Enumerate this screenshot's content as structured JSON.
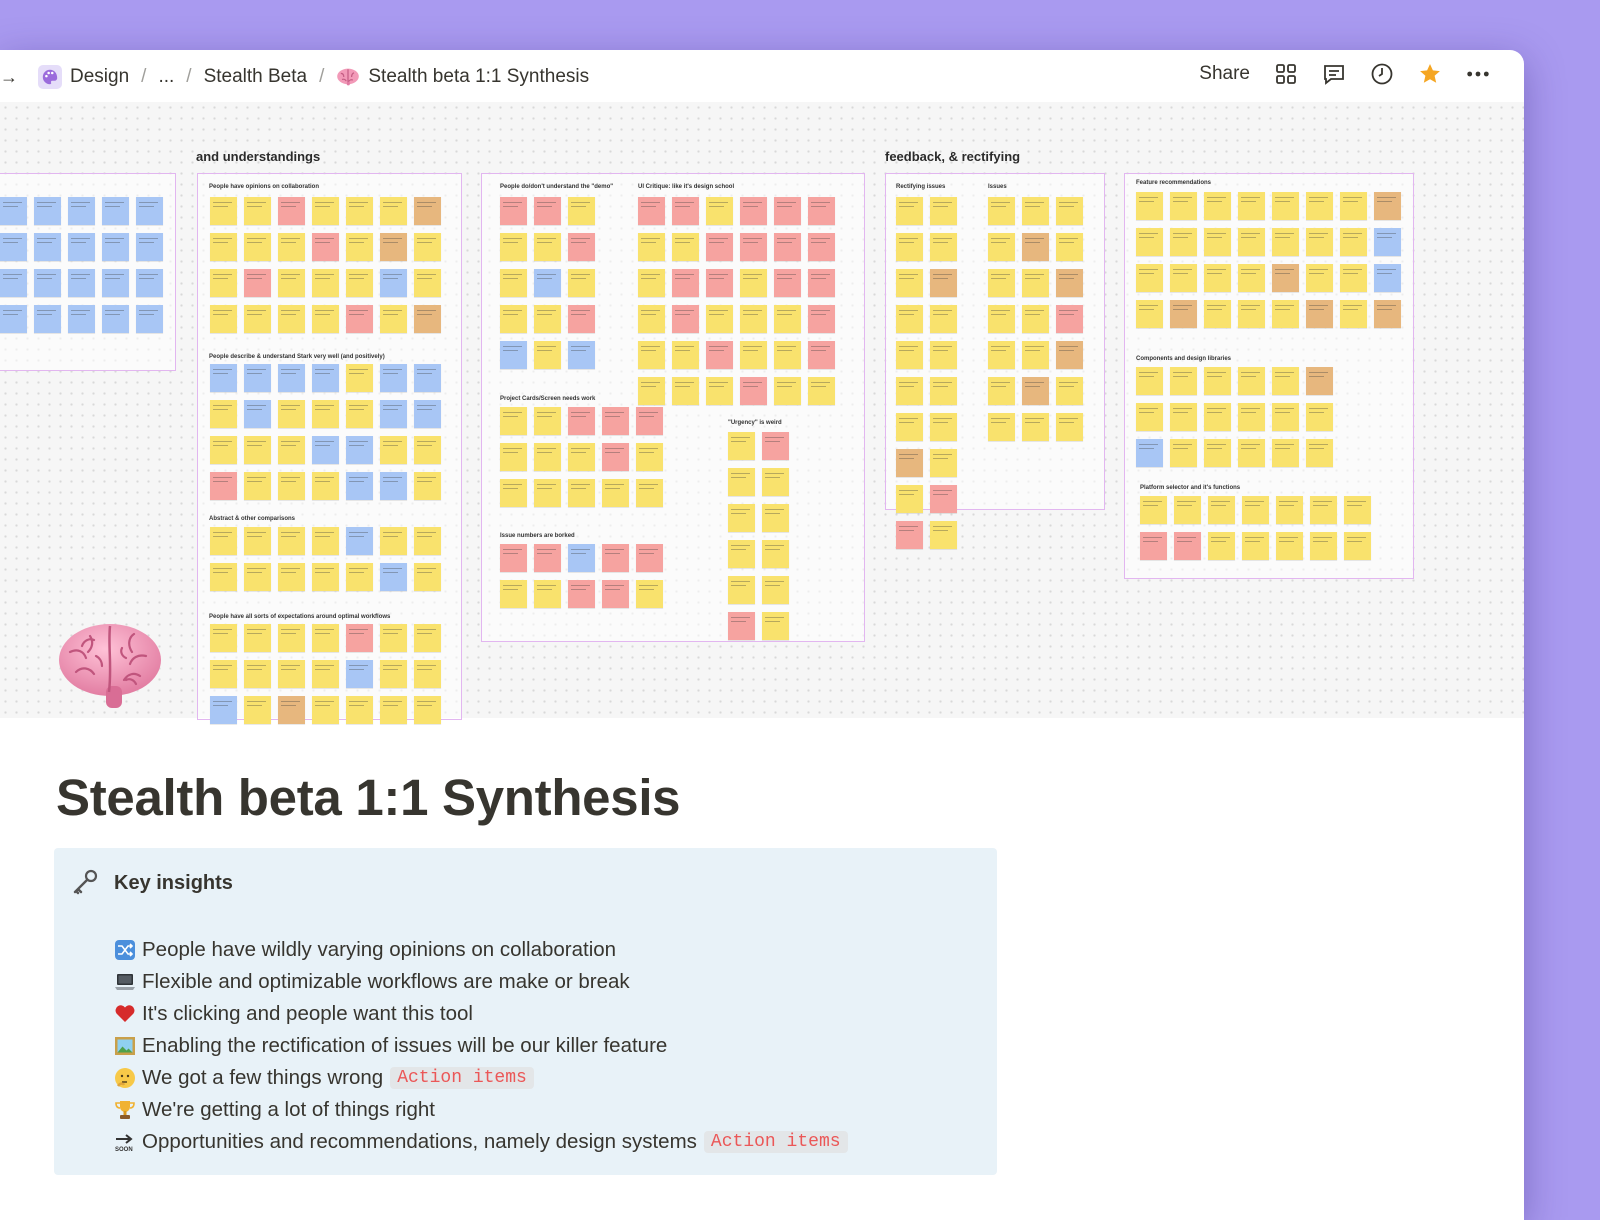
{
  "breadcrumbs": [
    {
      "label": "Design",
      "icon": "palette-icon"
    },
    {
      "label": "..."
    },
    {
      "label": "Stealth Beta"
    },
    {
      "label": "Stealth beta 1:1 Synthesis",
      "icon": "brain-icon"
    }
  ],
  "topbar": {
    "share_label": "Share",
    "icons": [
      "layout-grid-icon",
      "comment-icon",
      "history-clock-icon",
      "favorite-star-icon",
      "more-icon"
    ],
    "star_color": "#f5a623"
  },
  "board": {
    "headings": [
      "and understandings",
      "feedback, & rectifying"
    ],
    "groups": [
      "People have opinions on collaboration",
      "People describe & understand Stark very well (and positively)",
      "Abstract & other comparisons",
      "People have all sorts of expectations around optimal workflows",
      "People do/don't understand the \"demo\"",
      "UI Critique: like it's design school",
      "Project Cards/Screen needs work",
      "\"Urgency\" is weird",
      "Issue numbers are borked",
      "Rectifying issues",
      "Issues",
      "Feature recommendations",
      "Components and design libraries",
      "Platform selector and it's functions"
    ],
    "note_colors": {
      "yellow": "#f9e26d",
      "blue": "#a8c6f5",
      "red": "#f6a3a0",
      "orange": "#e7b77e"
    }
  },
  "page": {
    "icon": "brain-icon",
    "title": "Stealth beta 1:1 Synthesis"
  },
  "callout": {
    "icon": "old-key-icon",
    "title": "Key insights",
    "background": "#e8f2f8",
    "items": [
      {
        "icon": "shuffle-icon",
        "text": "People have wildly varying opinions on collaboration"
      },
      {
        "icon": "laptop-icon",
        "text": "Flexible and optimizable workflows are make or break"
      },
      {
        "icon": "red-heart-icon",
        "text": "It's clicking and people want this tool"
      },
      {
        "icon": "framed-picture-icon",
        "text": "Enabling the rectification of issues will be our killer feature"
      },
      {
        "icon": "thinking-face-icon",
        "text": "We got a few things wrong",
        "tag": "Action items"
      },
      {
        "icon": "trophy-icon",
        "text": "We're getting a lot of things right"
      },
      {
        "icon": "soon-arrow-icon",
        "text": "Opportunities and recommendations, namely design systems",
        "tag": "Action items"
      }
    ]
  }
}
